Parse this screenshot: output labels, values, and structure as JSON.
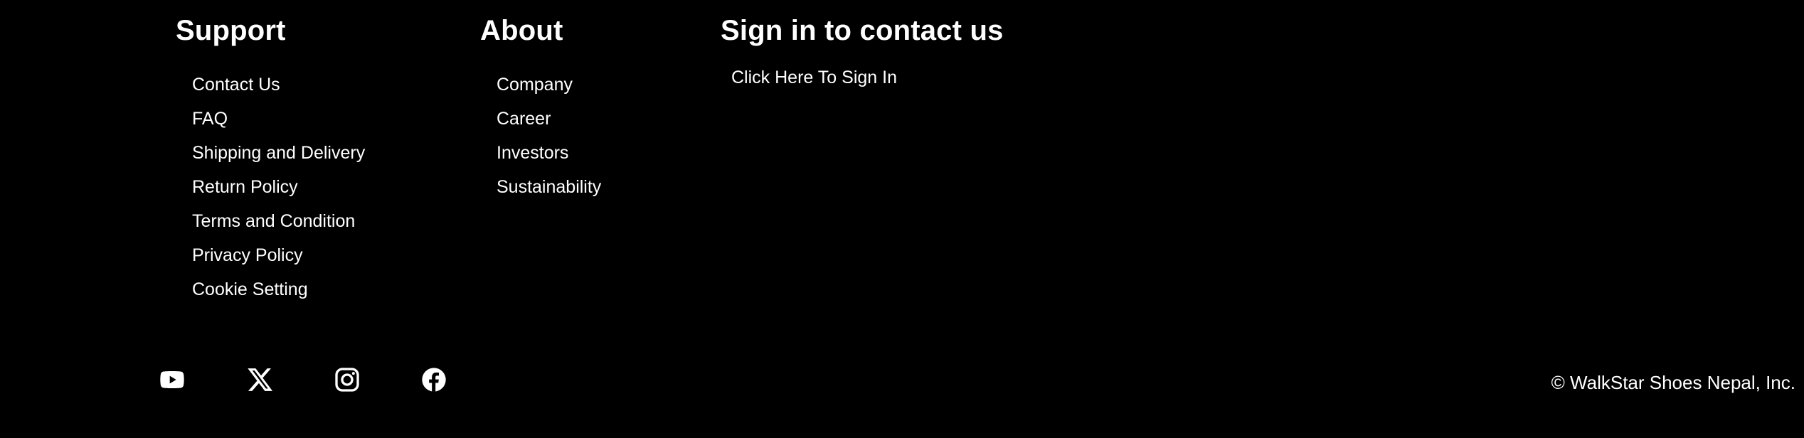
{
  "support": {
    "heading": "Support",
    "links": [
      {
        "label": "Contact Us"
      },
      {
        "label": "FAQ"
      },
      {
        "label": "Shipping and Delivery"
      },
      {
        "label": "Return Policy"
      },
      {
        "label": "Terms and Condition"
      },
      {
        "label": "Privacy Policy"
      },
      {
        "label": "Cookie Setting"
      }
    ]
  },
  "about": {
    "heading": "About",
    "links": [
      {
        "label": "Company"
      },
      {
        "label": "Career"
      },
      {
        "label": "Investors"
      },
      {
        "label": "Sustainability"
      }
    ]
  },
  "signin": {
    "heading": "Sign in to contact us",
    "link_label": "Click Here To Sign In"
  },
  "social": {
    "icons": [
      "youtube-icon",
      "x-icon",
      "instagram-icon",
      "facebook-icon"
    ]
  },
  "footer": {
    "copyright": "© WalkStar Shoes Nepal, Inc."
  },
  "colors": {
    "background": "#000000",
    "text": "#ffffff"
  }
}
